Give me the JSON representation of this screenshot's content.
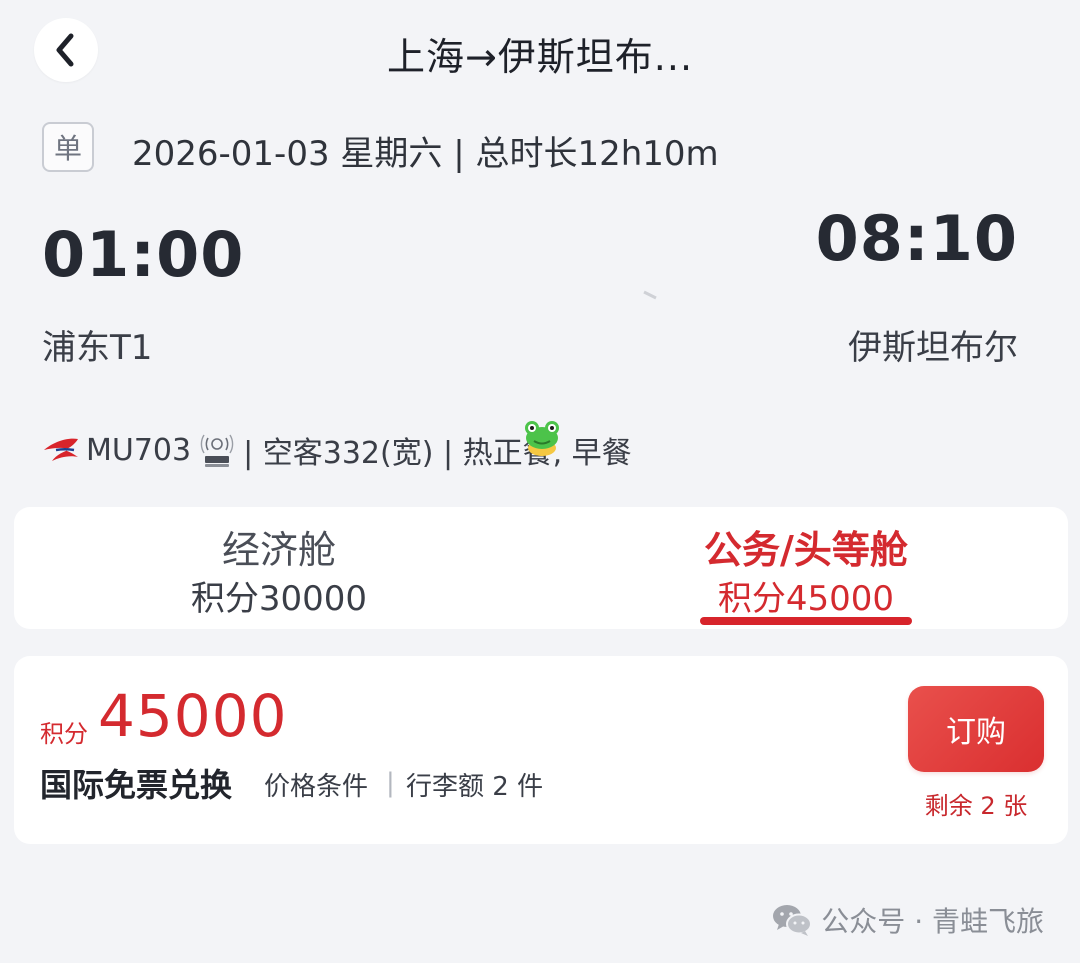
{
  "header": {
    "back_icon": "chevron-left-icon",
    "title": "上海→伊斯坦布..."
  },
  "trip": {
    "type_badge": "单",
    "date_line": "2026-01-03 星期六 | 总时长12h10m"
  },
  "flight": {
    "departure_time": "01:00",
    "arrival_time": "08:10",
    "departure_airport": "浦东T1",
    "arrival_airport": "伊斯坦布尔",
    "flight_number": "MU703",
    "airline_logo": "china-eastern-logo",
    "wifi_icon": "wifi-onboard-icon",
    "details": "| 空客332(宽) | 热正餐, 早餐"
  },
  "cabins": [
    {
      "name": "经济舱",
      "points": "积分30000"
    },
    {
      "name": "公务/头等舱",
      "points": "积分45000",
      "selected": true
    }
  ],
  "fare": {
    "points_label": "积分",
    "points_value": "45000",
    "fare_name": "国际免票兑换",
    "conditions": "价格条件",
    "divider": "|",
    "baggage": "行李额 2 件",
    "book_label": "订购",
    "seats_left": "剩余 2 张"
  },
  "watermark": {
    "icon": "wechat-icon",
    "text": "公众号 · 青蛙飞旅"
  },
  "colors": {
    "accent_red": "#d42a2f",
    "background": "#f3f4f7"
  }
}
